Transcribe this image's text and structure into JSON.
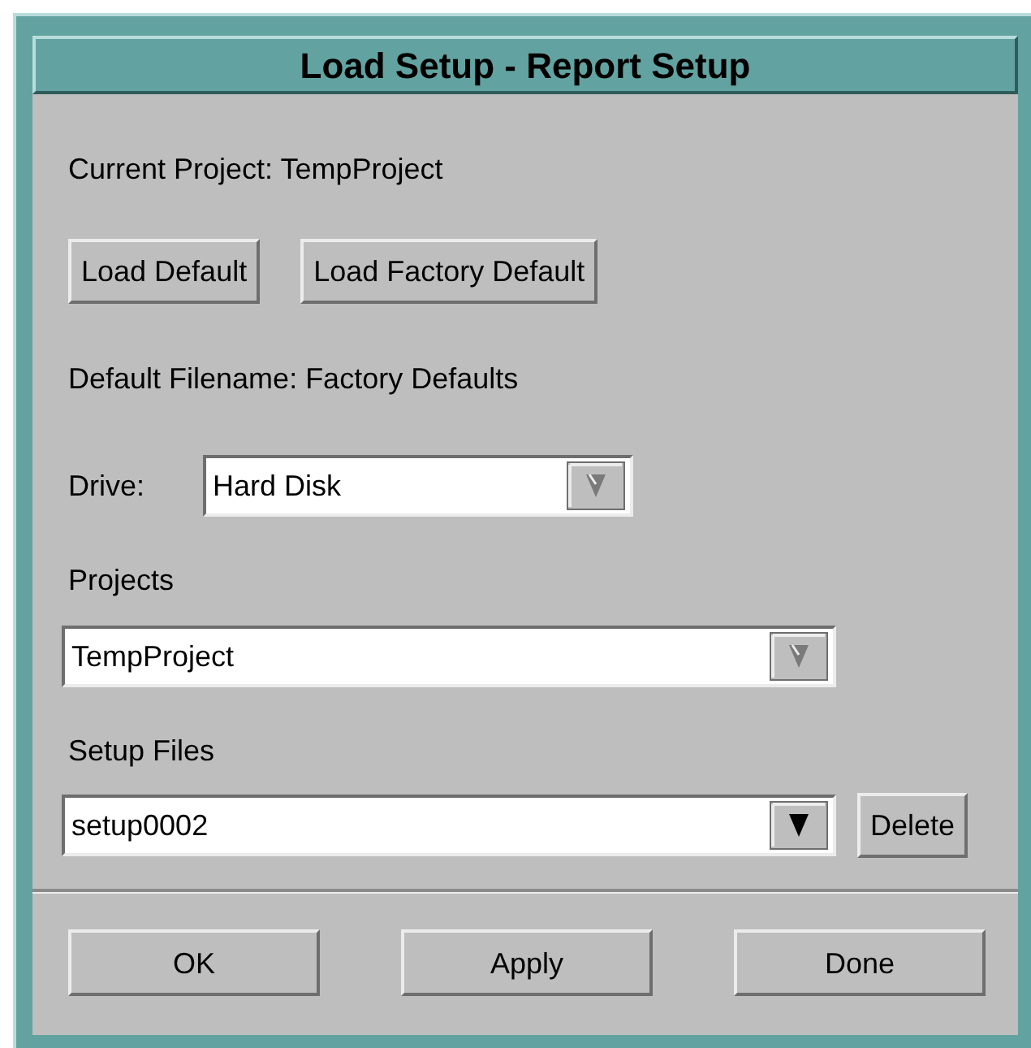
{
  "window": {
    "title": "Load Setup - Report Setup"
  },
  "current_project": "Current Project: TempProject",
  "top_buttons": [
    "Load Default",
    "Load Factory Default"
  ],
  "default_filename": "Default Filename: Factory Defaults",
  "drive": {
    "label": "Drive:",
    "value": "Hard Disk",
    "focused": false
  },
  "projects": {
    "label": "Projects",
    "value": "TempProject",
    "focused": false
  },
  "setup_files": {
    "label": "Setup Files",
    "value": "setup0002",
    "focused": true,
    "action": "Delete"
  },
  "bottom_buttons": [
    "OK",
    "Apply",
    "Done"
  ]
}
